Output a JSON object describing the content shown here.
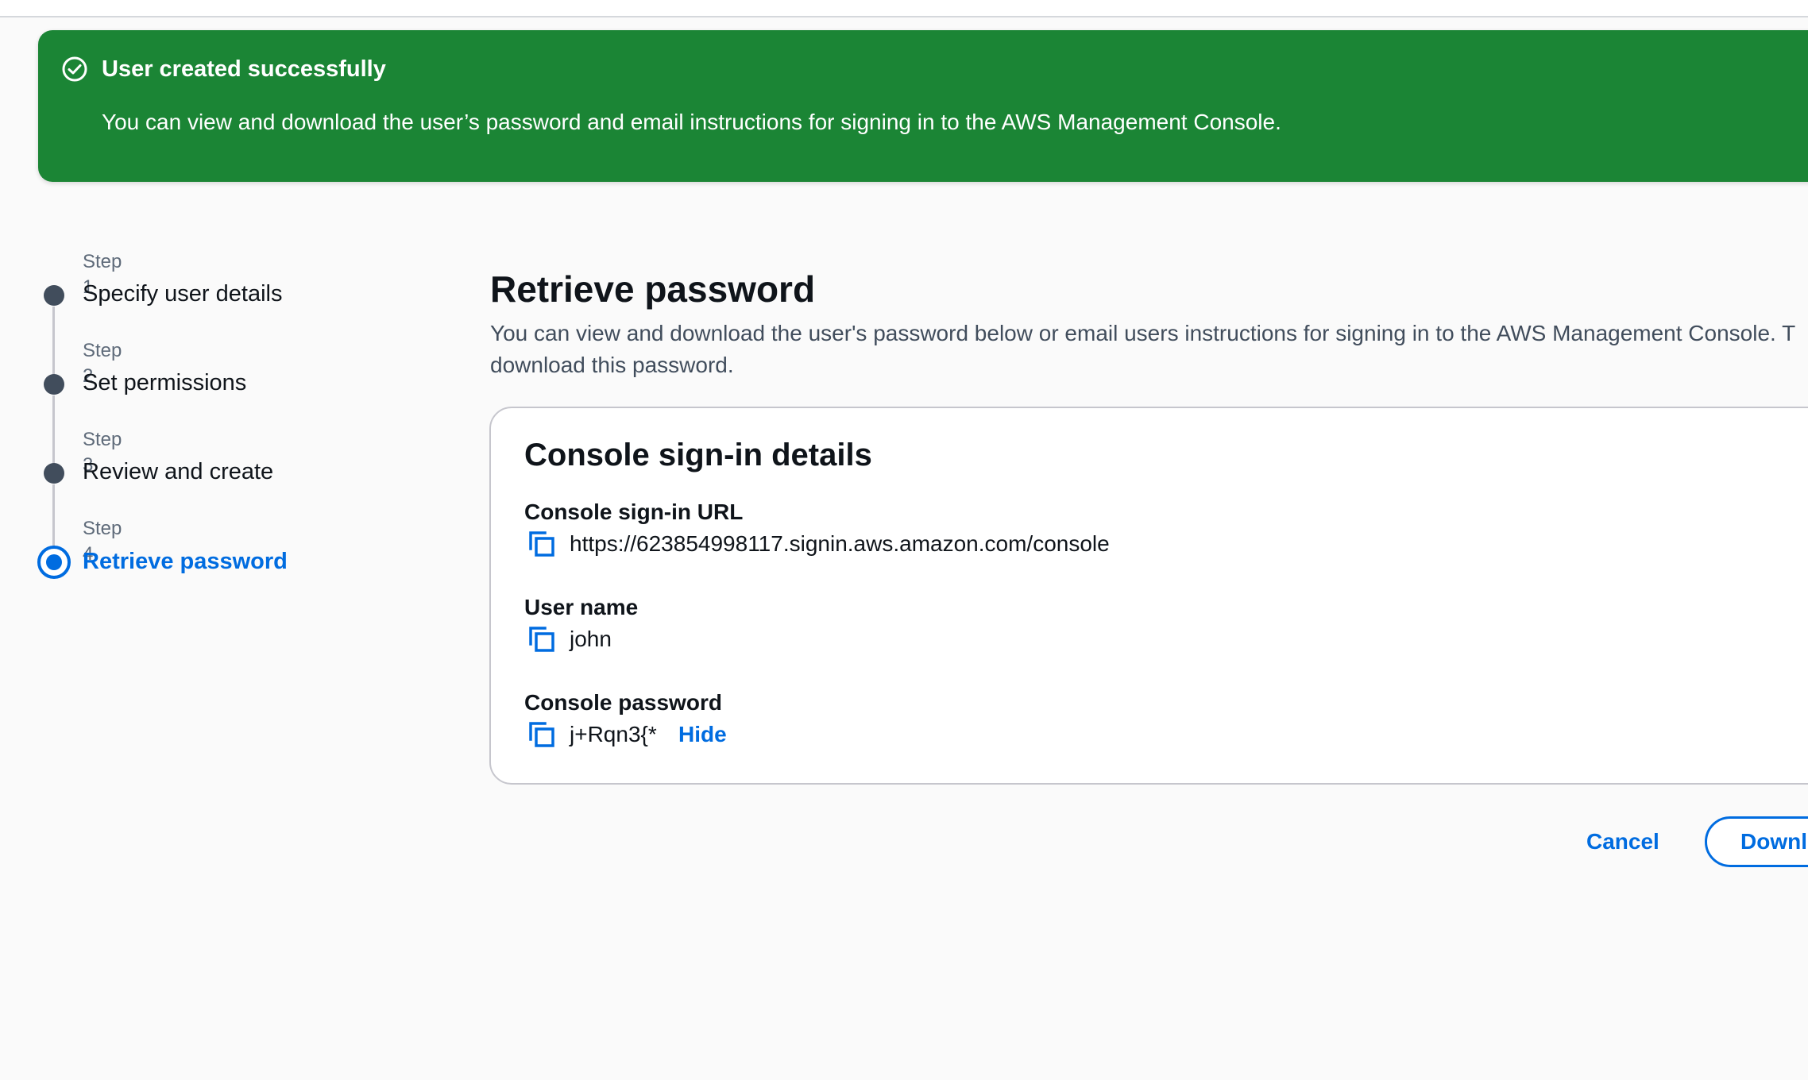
{
  "flash": {
    "icon": "check-circle-icon",
    "title": "User created successfully",
    "body": "You can view and download the user’s password and email instructions for signing in to the AWS Management Console."
  },
  "steps": [
    {
      "caption": "Step 1",
      "label": "Specify user details",
      "state": "complete"
    },
    {
      "caption": "Step 2",
      "label": "Set permissions",
      "state": "complete"
    },
    {
      "caption": "Step 3",
      "label": "Review and create",
      "state": "complete"
    },
    {
      "caption": "Step 4",
      "label": "Retrieve password",
      "state": "active"
    }
  ],
  "main": {
    "title": "Retrieve password",
    "description": "You can view and download the user's password below or email users instructions for signing in to the AWS Management Console. T download this password."
  },
  "card": {
    "title": "Console sign-in details",
    "fields": [
      {
        "label": "Console sign-in URL",
        "value": "https://623854998117.signin.aws.amazon.com/console",
        "icon": "copy-icon"
      },
      {
        "label": "User name",
        "value": "john",
        "icon": "copy-icon"
      },
      {
        "label": "Console password",
        "value": "j+Rqn3{*",
        "icon": "copy-icon",
        "toggle_label": "Hide"
      }
    ]
  },
  "actions": {
    "cancel_label": "Cancel",
    "download_label": "Downl"
  },
  "colors": {
    "success_green": "#1b8535",
    "link_blue": "#006ce0",
    "step_complete": "#414d5c",
    "background": "#fafafa"
  }
}
